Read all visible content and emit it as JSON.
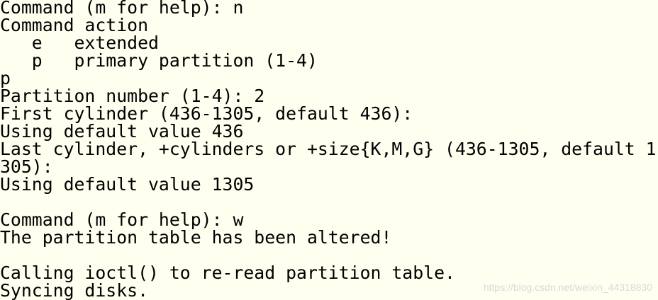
{
  "terminal": {
    "lines": [
      "Command (m for help): n",
      "Command action",
      "   e   extended",
      "   p   primary partition (1-4)",
      "p",
      "Partition number (1-4): 2",
      "First cylinder (436-1305, default 436):",
      "Using default value 436",
      "Last cylinder, +cylinders or +size{K,M,G} (436-1305, default 1",
      "305):",
      "Using default value 1305",
      "",
      "Command (m for help): w",
      "The partition table has been altered!",
      "",
      "Calling ioctl() to re-read partition table.",
      "Syncing disks."
    ]
  },
  "watermark": "https://blog.csdn.net/weixin_44318830",
  "colors": {
    "background": "#fffff0",
    "text": "#000000"
  }
}
